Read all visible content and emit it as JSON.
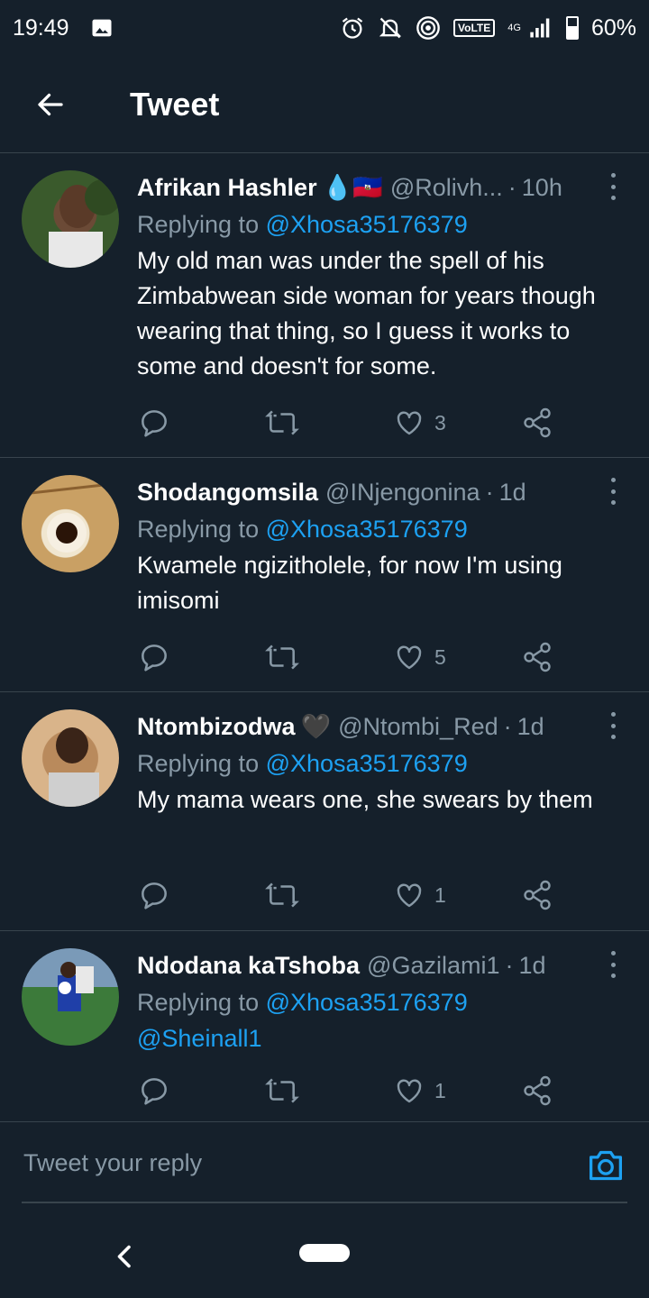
{
  "status": {
    "time": "19:49",
    "volte": "VoLTE",
    "network": "4G",
    "battery_percent": "60%",
    "battery_level": 0.6,
    "icons": [
      "image-icon",
      "alarm-icon",
      "mute-icon",
      "hotspot-icon",
      "signal-icon",
      "battery-icon"
    ]
  },
  "header": {
    "title": "Tweet",
    "back_icon": "back-arrow-icon"
  },
  "colors": {
    "background": "#15202b",
    "accent": "#1da1f2",
    "muted": "#8899a6",
    "divider": "#38444d"
  },
  "tweets": [
    {
      "name": "Afrikan Hashler",
      "emoji": "💧🇭🇹",
      "handle": "@Rolivh...",
      "time": "10h",
      "replying_label": "Replying to",
      "replying_to": "@Xhosa35176379",
      "text": "My old man was under the spell of his Zimbabwean side woman for years though wearing that thing, so I guess it works to some and doesn't for some.",
      "likes": "3"
    },
    {
      "name": "Shodangomsila",
      "handle": "@INjengonina",
      "time": "1d",
      "replying_label": "Replying to",
      "replying_to": "@Xhosa35176379",
      "text": "Kwamele ngizitholele, for now I'm using imisomi",
      "likes": "5"
    },
    {
      "name": "Ntombizodwa",
      "emoji": "🖤",
      "handle": "@Ntombi_Red",
      "time": "1d",
      "replying_label": "Replying to",
      "replying_to": "@Xhosa35176379",
      "text": "My mama wears one, she swears by them",
      "likes": "1"
    },
    {
      "name": "Ndodana kaTshoba",
      "handle": "@Gazilami1",
      "time": "1d",
      "replying_label": "Replying to",
      "replying_to": "@Xhosa35176379",
      "text": "@Sheinall1",
      "likes": "1"
    }
  ],
  "reply": {
    "placeholder": "Tweet your reply",
    "camera_icon": "camera-icon"
  }
}
